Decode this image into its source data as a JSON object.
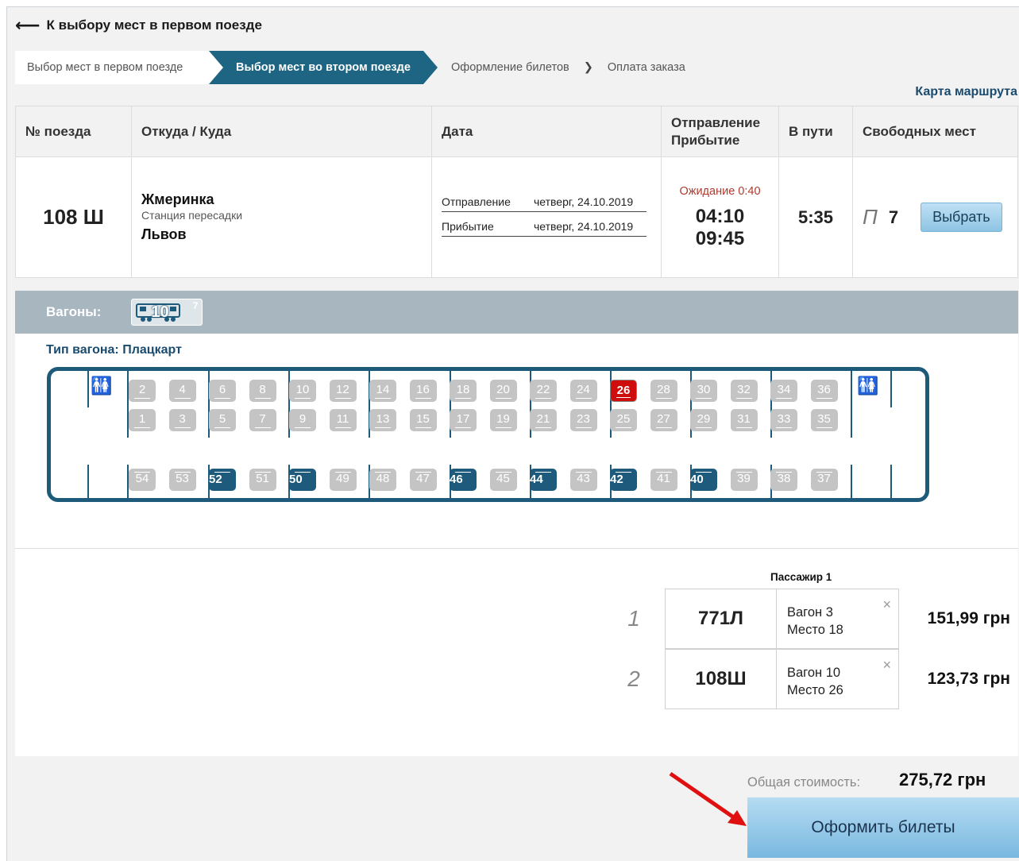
{
  "back_link": {
    "arrow": "⟵",
    "label": "К выбору мест в первом поезде"
  },
  "steps": [
    "Выбор мест в первом поезде",
    "Выбор мест во втором поезде",
    "Оформление билетов",
    "Оплата заказа"
  ],
  "step_separator": "❯",
  "route_map_link": "Карта маршрута",
  "table": {
    "headers": {
      "num": "№ поезда",
      "route": "Откуда / Куда",
      "date": "Дата",
      "depart_arrive_1": "Отправление",
      "depart_arrive_2": "Прибытие",
      "travel": "В пути",
      "free": "Свободных мест"
    },
    "row": {
      "train": "108 Ш",
      "from": "Жмеринка",
      "transfer": "Станция пересадки",
      "to": "Львов",
      "depart_label": "Отправление",
      "depart_date": "четверг, 24.10.2019",
      "arrive_label": "Прибытие",
      "arrive_date": "четверг, 24.10.2019",
      "wait": "Ожидание 0:40",
      "depart_time": "04:10",
      "arrive_time": "09:45",
      "travel_time": "5:35",
      "class": "П",
      "free_count": "7",
      "select_button": "Выбрать"
    }
  },
  "wagons": {
    "label": "Вагоны:",
    "wagon_number": "10",
    "wagon_free": "7",
    "type_label": "Тип вагона: Плацкарт"
  },
  "seats": {
    "upper_top": [
      "2",
      "4",
      "6",
      "8",
      "10",
      "12",
      "14",
      "16",
      "18",
      "20",
      "22",
      "24",
      "26",
      "28",
      "30",
      "32",
      "34",
      "36"
    ],
    "upper_bottom": [
      "1",
      "3",
      "5",
      "7",
      "9",
      "11",
      "13",
      "15",
      "17",
      "19",
      "21",
      "23",
      "25",
      "27",
      "29",
      "31",
      "33",
      "35"
    ],
    "side": [
      "54",
      "53",
      "52",
      "51",
      "50",
      "49",
      "48",
      "47",
      "46",
      "45",
      "44",
      "43",
      "42",
      "41",
      "40",
      "39",
      "38",
      "37"
    ],
    "free": [
      "52",
      "50",
      "46",
      "44",
      "42",
      "40"
    ],
    "selected": "26"
  },
  "summary": {
    "passenger_head": "Пассажир 1",
    "tickets": [
      {
        "idx": "1",
        "train": "771Л",
        "wagon": "Вагон 3",
        "seat": "Место 18",
        "price": "151,99 грн"
      },
      {
        "idx": "2",
        "train": "108Ш",
        "wagon": "Вагон 10",
        "seat": "Место 26",
        "price": "123,73 грн"
      }
    ],
    "remove_icon": "×",
    "total_label": "Общая стоимость:",
    "total_value": "275,72 грн",
    "checkout_button": "Оформить билеты"
  },
  "colors": {
    "accent": "#1d6583",
    "selected_seat": "#d00d0d",
    "free_seat": "#1d5a7c",
    "taken_seat": "#c4c4c4",
    "wait_text": "#b03a2e",
    "annotation_arrow": "#e01010"
  }
}
